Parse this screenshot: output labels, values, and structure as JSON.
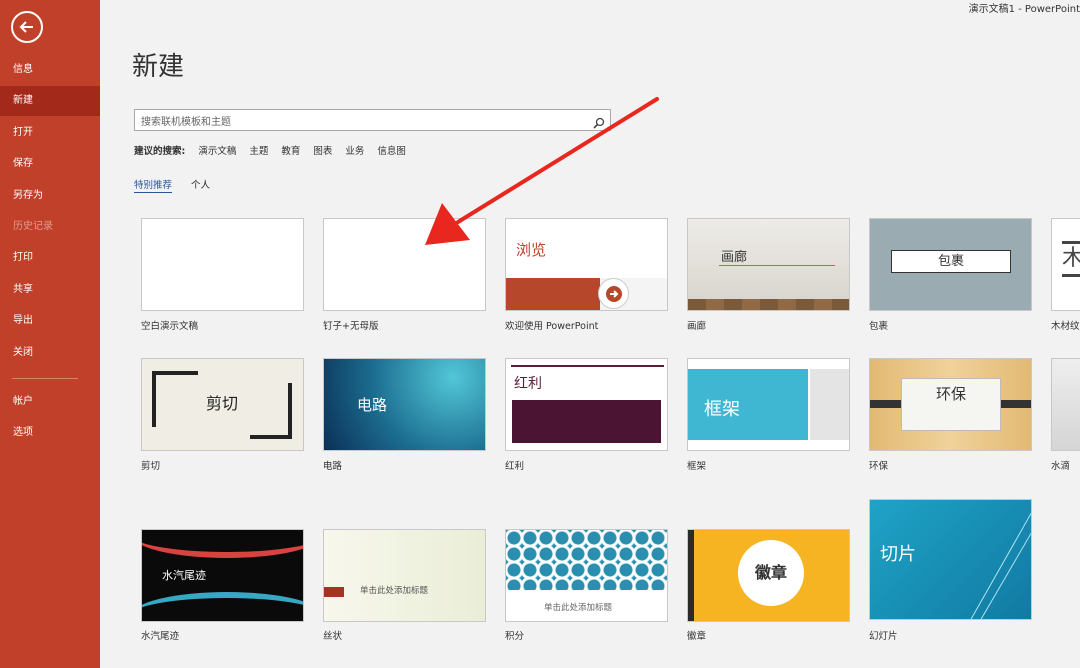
{
  "app": {
    "title": "演示文稿1 - PowerPoint"
  },
  "sidebar": {
    "items": [
      {
        "label": "信息"
      },
      {
        "label": "新建"
      },
      {
        "label": "打开"
      },
      {
        "label": "保存"
      },
      {
        "label": "另存为"
      },
      {
        "label": "历史记录"
      },
      {
        "label": "打印"
      },
      {
        "label": "共享"
      },
      {
        "label": "导出"
      },
      {
        "label": "关闭"
      },
      {
        "label": "帐户"
      },
      {
        "label": "选项"
      }
    ]
  },
  "page": {
    "title": "新建"
  },
  "search": {
    "placeholder": "搜索联机模板和主题"
  },
  "suggested": {
    "label": "建议的搜索:",
    "terms": [
      "演示文稿",
      "主题",
      "教育",
      "图表",
      "业务",
      "信息图"
    ]
  },
  "tabs": [
    {
      "label": "特别推荐"
    },
    {
      "label": "个人"
    }
  ],
  "templates": [
    {
      "name": "空白演示文稿"
    },
    {
      "name": "钉子+无母版"
    },
    {
      "name": "欢迎使用 PowerPoint",
      "thumb": "浏览"
    },
    {
      "name": "画廊",
      "thumb": "画廊"
    },
    {
      "name": "包裹",
      "thumb": "包裹"
    },
    {
      "name": "木材纹",
      "thumb": "木"
    },
    {
      "name": "剪切",
      "thumb": "剪切"
    },
    {
      "name": "电路",
      "thumb": "电路"
    },
    {
      "name": "红利",
      "thumb": "红利"
    },
    {
      "name": "框架",
      "thumb": "框架"
    },
    {
      "name": "环保",
      "thumb": "环保"
    },
    {
      "name": "水滴"
    },
    {
      "name": "水汽尾迹",
      "thumb": "水汽尾迹"
    },
    {
      "name": "丝状",
      "thumb": "单击此处添加标题"
    },
    {
      "name": "积分",
      "thumb": "单击此处添加标题"
    },
    {
      "name": "徽章",
      "thumb": "徽章"
    },
    {
      "name": "幻灯片",
      "thumb": "切片"
    }
  ],
  "colors": {
    "sidebar": "#c0402a",
    "sidebar_active": "#a3291b",
    "link": "#2b579a",
    "arrow": "#e8281e"
  }
}
